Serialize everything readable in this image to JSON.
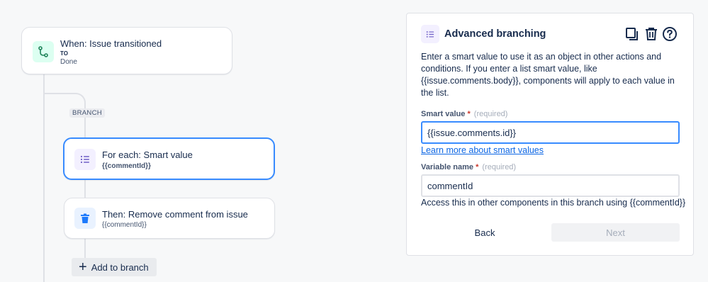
{
  "flow": {
    "trigger": {
      "title": "When: Issue transitioned",
      "to_label": "TO",
      "to_value": "Done",
      "icon": "branch-route-icon"
    },
    "branch_tag": "BRANCH",
    "foreach": {
      "title": "For each: Smart value",
      "sub": "{{commentId}}",
      "icon": "list-icon"
    },
    "remove": {
      "title": "Then: Remove comment from issue",
      "sub": "{{commentId}}",
      "icon": "trash-icon"
    },
    "add_branch_label": "Add to branch"
  },
  "panel": {
    "title": "Advanced branching",
    "icon": "list-icon",
    "tools": [
      "copy-icon",
      "trash-icon",
      "help-icon"
    ],
    "description": "Enter a smart value to use it as an object in other actions and conditions. If you enter a list smart value, like {{issue.comments.body}}, components will apply to each value in the list.",
    "smart_value": {
      "label": "Smart value",
      "required_mark": "*",
      "hint": "(required)",
      "value": "{{issue.comments.id}}"
    },
    "learn_more": "Learn more about smart values",
    "variable_name": {
      "label": "Variable name",
      "required_mark": "*",
      "hint": "(required)",
      "value": "commentId"
    },
    "help_text": "Access this in other components in this branch using {{commentId}}",
    "back_label": "Back",
    "next_label": "Next"
  },
  "colors": {
    "accent": "#388bff",
    "link": "#0c66e4",
    "trigger_icon": "#1f845a",
    "required": "#c9372c"
  }
}
